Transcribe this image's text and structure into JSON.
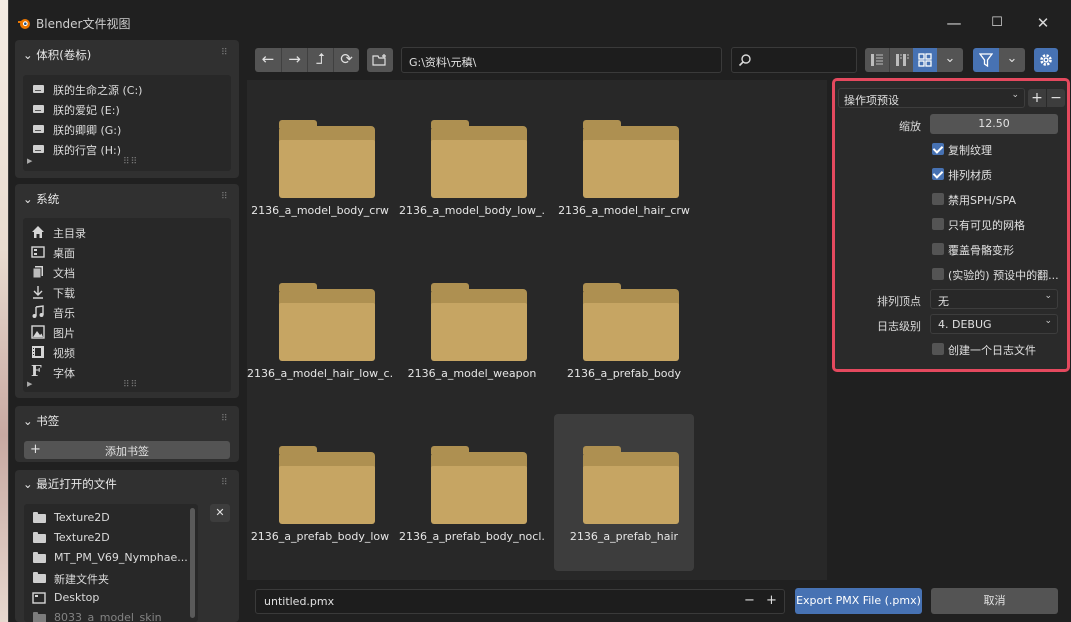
{
  "window": {
    "title": "Blender文件视图",
    "controls": {
      "minimize": "—",
      "maximize": "☐",
      "close": "✕"
    }
  },
  "volumes": {
    "header": "体积(卷标)",
    "items": [
      {
        "label": "朕的生命之源 (C:)",
        "icon": "drive-icon"
      },
      {
        "label": "朕的爱妃 (E:)",
        "icon": "drive-icon"
      },
      {
        "label": "朕的卿卿 (G:)",
        "icon": "drive-icon"
      },
      {
        "label": "朕的行宫 (H:)",
        "icon": "drive-icon"
      }
    ]
  },
  "system": {
    "header": "系统",
    "items": [
      {
        "label": "主目录",
        "icon": "home-icon"
      },
      {
        "label": "桌面",
        "icon": "desktop-icon"
      },
      {
        "label": "文档",
        "icon": "documents-icon"
      },
      {
        "label": "下载",
        "icon": "download-icon"
      },
      {
        "label": "音乐",
        "icon": "music-icon"
      },
      {
        "label": "图片",
        "icon": "image-icon"
      },
      {
        "label": "视频",
        "icon": "video-icon"
      },
      {
        "label": "字体",
        "icon": "font-icon"
      }
    ]
  },
  "bookmarks": {
    "header": "书签",
    "add_label": "添加书签",
    "add_icon": "+"
  },
  "recent": {
    "header": "最近打开的文件",
    "items": [
      {
        "label": "Texture2D",
        "icon": "folder-icon"
      },
      {
        "label": "Texture2D",
        "icon": "folder-icon"
      },
      {
        "label": "MT_PM_V69_Nymphae...",
        "icon": "folder-icon"
      },
      {
        "label": "新建文件夹",
        "icon": "folder-icon"
      },
      {
        "label": "Desktop",
        "icon": "desktop-icon"
      },
      {
        "label": "8033_a_model_skin",
        "icon": "folder-icon"
      }
    ],
    "clear_icon": "✕"
  },
  "toolbar": {
    "back": "←",
    "forward": "→",
    "parent": "⮥",
    "refresh": "⟳",
    "new_folder": "+",
    "path": "G:\\资料\\元稹\\",
    "search_placeholder": "",
    "filter_chevron": "⌄",
    "display_chevron": "⌄"
  },
  "files": [
    {
      "name": "2136_a_model_body_crw",
      "selected": false
    },
    {
      "name": "2136_a_model_body_low_...",
      "selected": false
    },
    {
      "name": "2136_a_model_hair_crw",
      "selected": false
    },
    {
      "name": "2136_a_model_hair_low_c...",
      "selected": false
    },
    {
      "name": "2136_a_model_weapon",
      "selected": false
    },
    {
      "name": "2136_a_prefab_body",
      "selected": false
    },
    {
      "name": "2136_a_prefab_body_low",
      "selected": false
    },
    {
      "name": "2136_a_prefab_body_nocl...",
      "selected": false
    },
    {
      "name": "2136_a_prefab_hair",
      "selected": true
    }
  ],
  "options": {
    "preset_label": "操作项预设",
    "preset_add": "+",
    "preset_remove": "−",
    "scale_label": "缩放",
    "scale_value": "12.50",
    "checkboxes": [
      {
        "label": "复制纹理",
        "checked": true
      },
      {
        "label": "排列材质",
        "checked": true
      },
      {
        "label": "禁用SPH/SPA",
        "checked": false
      },
      {
        "label": "只有可见的网格",
        "checked": false
      },
      {
        "label": "覆盖骨骼变形",
        "checked": false
      },
      {
        "label": "(实验的) 预设中的翻...",
        "checked": false
      }
    ],
    "sort_vertices_label": "排列顶点",
    "sort_vertices_value": "无",
    "log_level_label": "日志级别",
    "log_level_value": "4. DEBUG",
    "create_log": {
      "label": "创建一个日志文件",
      "checked": false
    }
  },
  "footer": {
    "filename": "untitled.pmx",
    "decrement": "−",
    "increment": "+",
    "export_label": "Export PMX File (.pmx)",
    "cancel_label": "取消"
  },
  "colors": {
    "accent": "#4772b3",
    "highlight_border": "#e4495e",
    "folder": "#c6a563"
  }
}
